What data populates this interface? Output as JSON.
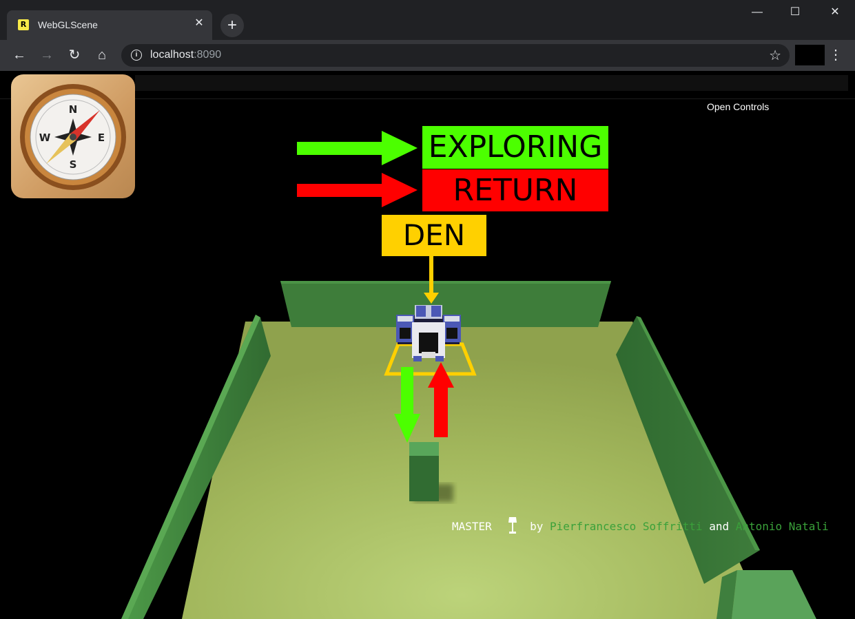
{
  "browser": {
    "tab_title": "WebGLScene",
    "favicon_letter": "R",
    "tab_close": "✕",
    "new_tab": "+",
    "url_host": "localhost",
    "url_port": ":8090",
    "window_controls": {
      "minimize": "—",
      "maximize": "☐",
      "close": "✕"
    }
  },
  "page": {
    "open_controls_label": "Open Controls",
    "labels": {
      "exploring": "EXPLORING",
      "return": "RETURN",
      "den": "DEN"
    },
    "compass_letters": {
      "north": "N",
      "south": "S",
      "east": "E",
      "west": "W"
    },
    "credits": {
      "mode": "MASTER",
      "by": "by",
      "author1": "Pierfrancesco Soffritti",
      "and": "and",
      "author2": "Antonio Natali"
    },
    "colors": {
      "exploring": "#4cff00",
      "return": "#ff0000",
      "den": "#ffd000",
      "floor": "#9fb35a",
      "wall": "#3e7d3a",
      "author_link": "#3aa13a"
    }
  }
}
